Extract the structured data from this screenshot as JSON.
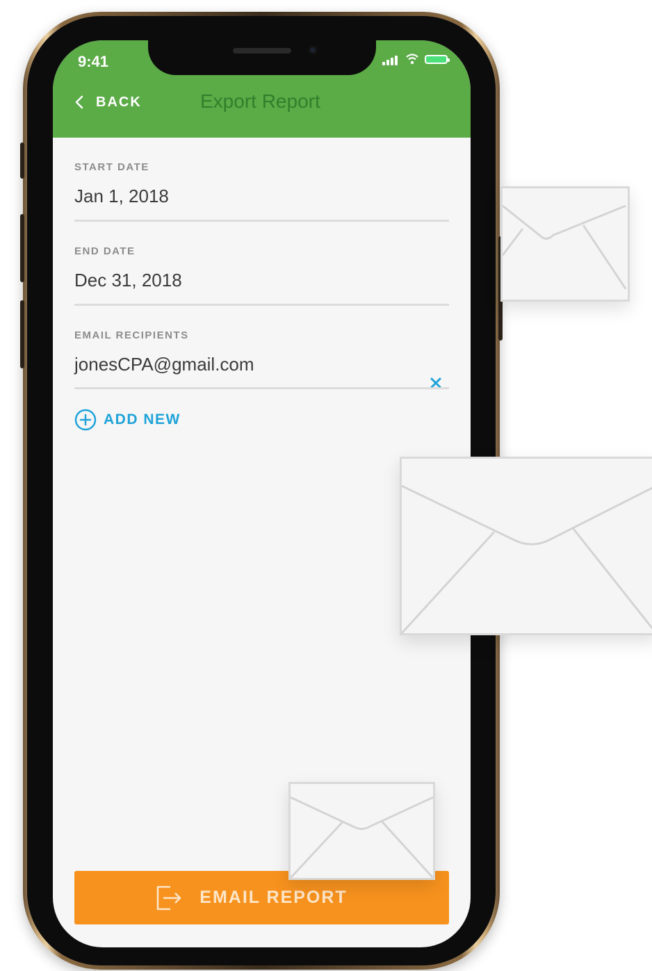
{
  "status_bar": {
    "time": "9:41",
    "icons": [
      "signal-icon",
      "wifi-icon",
      "battery-icon"
    ]
  },
  "header": {
    "back_label": "BACK",
    "title": "Export Report"
  },
  "form": {
    "start_date": {
      "label": "START DATE",
      "value": "Jan 1, 2018"
    },
    "end_date": {
      "label": "END DATE",
      "value": "Dec 31, 2018"
    },
    "email_recipients": {
      "label": "EMAIL RECIPIENTS",
      "value": "jonesCPA@gmail.com"
    },
    "add_new_label": "ADD NEW"
  },
  "footer": {
    "email_report_label": "EMAIL REPORT"
  },
  "colors": {
    "header_green": "#5bab47",
    "title_green": "#327f2b",
    "accent_blue": "#1fa3d9",
    "button_orange": "#f7921e"
  }
}
